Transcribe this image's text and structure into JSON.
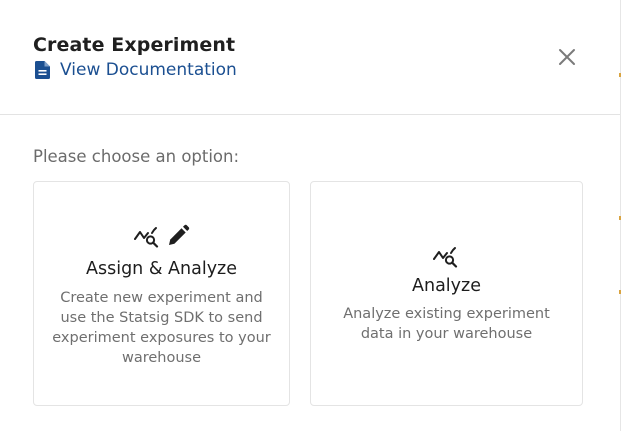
{
  "modal": {
    "title": "Create Experiment",
    "doc_link_label": "View Documentation",
    "prompt": "Please choose an option:"
  },
  "icons": {
    "doc": "document-icon",
    "close": "close-icon",
    "analyze": "chart-search-icon",
    "edit": "pencil-icon"
  },
  "options": [
    {
      "title": "Assign & Analyze",
      "description": "Create new experiment and use the Statsig SDK to send experiment exposures to your warehouse"
    },
    {
      "title": "Analyze",
      "description": "Analyze existing experiment data in your warehouse"
    }
  ],
  "colors": {
    "link": "#1b4f91",
    "title": "#1f1f1f",
    "muted": "#6f6f6f",
    "border": "#e4e4e4"
  }
}
